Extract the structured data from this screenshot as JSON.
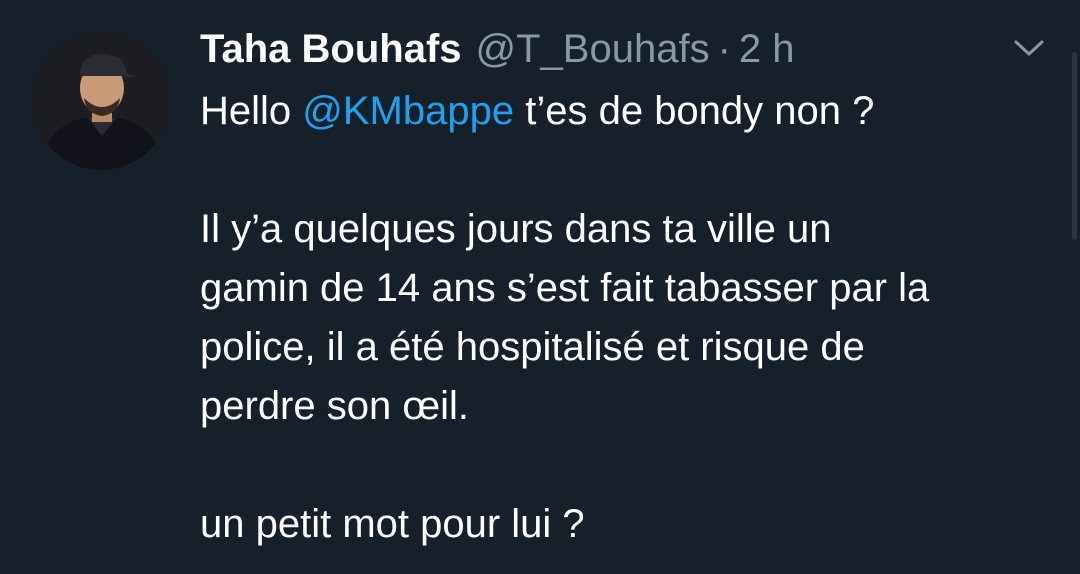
{
  "tweet": {
    "author": {
      "display_name": "Taha Bouhafs",
      "handle": "@T_Bouhafs",
      "separator": "·",
      "time": "2 h"
    },
    "menu_icon": "chevron-down-icon",
    "line1": {
      "prefix": "Hello ",
      "mention": "@KMbappe",
      "suffix": " t’es de bondy non ?"
    },
    "lines_para2": [
      "Il y’a quelques jours dans ta ville un",
      "gamin de 14 ans s’est fait tabasser par la",
      "police, il a été hospitalisé et risque de",
      "perdre son œil."
    ],
    "line_last": "un petit mot pour lui ?"
  },
  "colors": {
    "background": "#15202b",
    "text": "#ffffff",
    "secondary": "#8899a6",
    "accent": "#1da1f2"
  }
}
